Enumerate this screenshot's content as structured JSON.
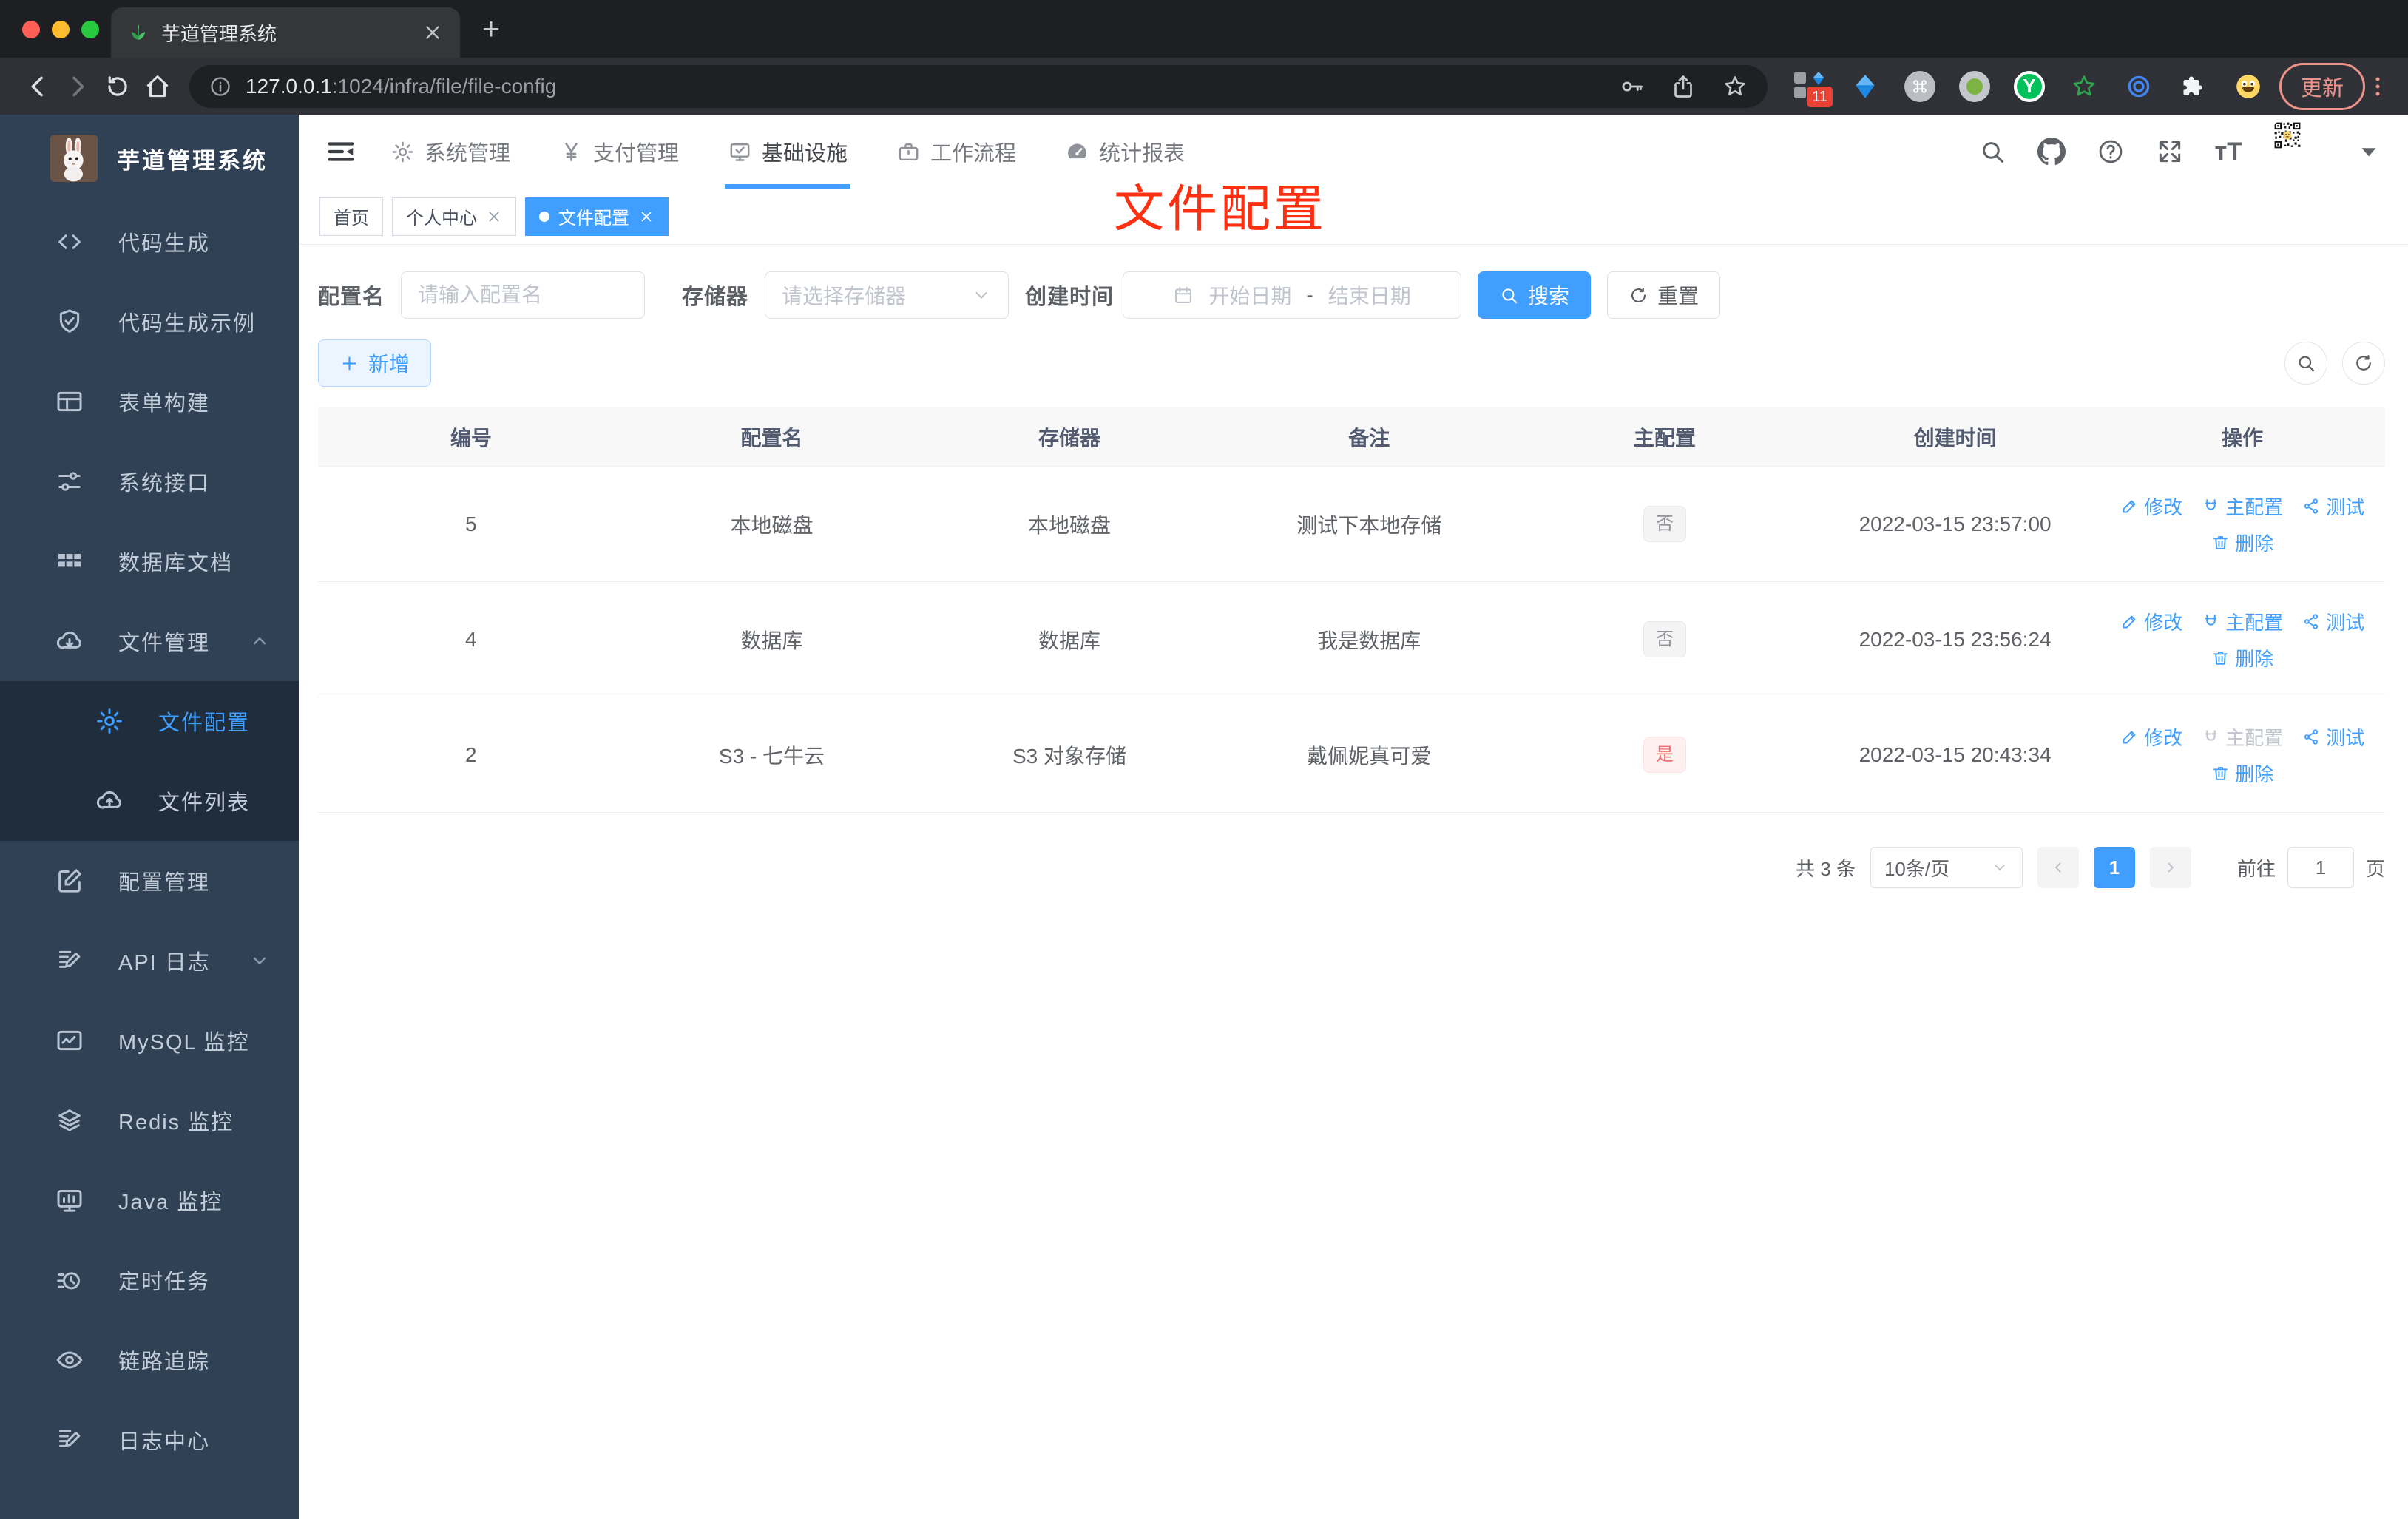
{
  "browser": {
    "tab_title": "芋道管理系统",
    "new_tab": "+",
    "url_host": "127.0.0.1",
    "url_path": ":1024/infra/file/file-config",
    "ext_badge": "11",
    "ext_y_label": "Y",
    "update_label": "更新"
  },
  "sidebar": {
    "app_title": "芋道管理系统",
    "items": [
      "代码生成",
      "代码生成示例",
      "表单构建",
      "系统接口",
      "数据库文档",
      "文件管理",
      "配置管理",
      "API 日志",
      "MySQL 监控",
      "Redis 监控",
      "Java 监控",
      "定时任务",
      "链路追踪",
      "日志中心"
    ],
    "submenu": [
      "文件配置",
      "文件列表"
    ]
  },
  "topnav": {
    "items": [
      "系统管理",
      "支付管理",
      "基础设施",
      "工作流程",
      "统计报表"
    ]
  },
  "tags": [
    "首页",
    "个人中心",
    "文件配置"
  ],
  "annotation": {
    "text": "文件配置",
    "color": "#ff2f12"
  },
  "filters": {
    "name_label": "配置名",
    "name_placeholder": "请输入配置名",
    "storage_label": "存储器",
    "storage_placeholder": "请选择存储器",
    "date_label": "创建时间",
    "date_start": "开始日期",
    "date_sep": "-",
    "date_end": "结束日期",
    "search_label": "搜索",
    "reset_label": "重置"
  },
  "toolbar": {
    "add_label": "新增"
  },
  "table": {
    "columns": [
      "编号",
      "配置名",
      "存储器",
      "备注",
      "主配置",
      "创建时间",
      "操作"
    ],
    "actions": {
      "edit": "修改",
      "master": "主配置",
      "test": "测试",
      "delete": "删除"
    },
    "rows": [
      {
        "id": "5",
        "name": "本地磁盘",
        "storage": "本地磁盘",
        "remark": "测试下本地存储",
        "master": "否",
        "created": "2022-03-15 23:57:00"
      },
      {
        "id": "4",
        "name": "数据库",
        "storage": "数据库",
        "remark": "我是数据库",
        "master": "否",
        "created": "2022-03-15 23:56:24"
      },
      {
        "id": "2",
        "name": "S3 - 七牛云",
        "storage": "S3 对象存储",
        "remark": "戴佩妮真可爱",
        "master": "是",
        "created": "2022-03-15 20:43:34"
      }
    ]
  },
  "pagination": {
    "total": "共 3 条",
    "page_size": "10条/页",
    "current": "1",
    "goto_label": "前往",
    "goto_value": "1",
    "unit_label": "页"
  },
  "colors": {
    "primary": "#409eff",
    "sidebar_bg": "#304156",
    "submenu_bg": "#1f2d3d",
    "tag_no": "#909399",
    "tag_yes": "#f56c6c",
    "update_red": "#ec9289"
  }
}
